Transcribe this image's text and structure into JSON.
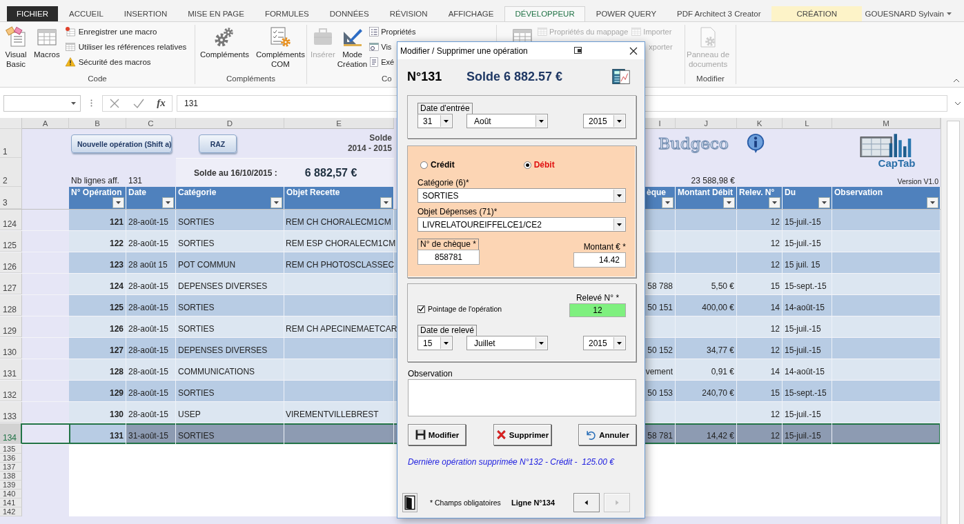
{
  "ribbon_tabs": [
    {
      "label": "FICHIER",
      "selected": false,
      "kind": "file"
    },
    {
      "label": "ACCUEIL",
      "selected": false,
      "kind": "tab"
    },
    {
      "label": "INSERTION",
      "selected": false,
      "kind": "tab"
    },
    {
      "label": "MISE EN PAGE",
      "selected": false,
      "kind": "tab"
    },
    {
      "label": "FORMULES",
      "selected": false,
      "kind": "tab"
    },
    {
      "label": "DONNÉES",
      "selected": false,
      "kind": "tab"
    },
    {
      "label": "RÉVISION",
      "selected": false,
      "kind": "tab"
    },
    {
      "label": "AFFICHAGE",
      "selected": false,
      "kind": "tab"
    },
    {
      "label": "DÉVELOPPEUR",
      "selected": true,
      "kind": "tab"
    },
    {
      "label": "POWER QUERY",
      "selected": false,
      "kind": "tab"
    },
    {
      "label": "PDF Architect 3 Creator",
      "selected": false,
      "kind": "tab"
    },
    {
      "label": "CRÉATION",
      "selected": false,
      "kind": "contextual"
    }
  ],
  "user": "GOUESNARD Sylvain",
  "ribbon_groups": [
    {
      "label": "Code",
      "large": [
        {
          "label": "Visual\nBasic",
          "disabled": false
        },
        {
          "label": "Macros",
          "disabled": false
        }
      ],
      "small": [
        {
          "label": "Enregistrer une macro",
          "disabled": false
        },
        {
          "label": "Utiliser les références relatives",
          "disabled": false
        },
        {
          "label": "Sécurité des macros",
          "disabled": false
        }
      ]
    },
    {
      "label": "Compléments",
      "large": [
        {
          "label": "Compléments",
          "disabled": false
        },
        {
          "label": "Compléments\nCOM",
          "disabled": false
        }
      ]
    },
    {
      "label": "Co",
      "large": [
        {
          "label": "Insérer",
          "disabled": true
        },
        {
          "label": "Mode\nCréation",
          "disabled": false
        }
      ],
      "small": [
        {
          "label": "Propriétés",
          "disabled": false
        },
        {
          "label": "Vis",
          "disabled": false
        },
        {
          "label": "Exé",
          "disabled": false
        }
      ]
    },
    {
      "large": [
        {
          "disabled": false
        }
      ],
      "small": [
        {
          "label": "Propriétés du mappage",
          "disabled": true
        },
        {
          "label": "Importer",
          "disabled": true
        },
        {
          "label": "xporter",
          "disabled": true
        }
      ]
    },
    {
      "label": "Modifier",
      "large": [
        {
          "label": "Panneau de\ndocuments",
          "disabled": true
        }
      ]
    }
  ],
  "formula_bar": {
    "function_label": "fx",
    "value": "131"
  },
  "sheet": {
    "columns": [
      "A",
      "B",
      "C",
      "D",
      "E",
      "I",
      "J",
      "K",
      "L",
      "M"
    ],
    "top_rows": [
      "1",
      "2",
      "3"
    ],
    "buttons": [
      "Nouvelle opération (Shift a)",
      "RAZ"
    ],
    "solde_title": [
      "Solde",
      "2014 - 2015"
    ],
    "logo": "Budgeco",
    "brand": "CapTab",
    "nb_lines_label": "Nb lignes aff.",
    "nb_lines_value": "131",
    "solde_label": "Solde au 16/10/2015 :",
    "solde_value": "6 882,57 €",
    "total_debit": "23 588,98 €",
    "version": "Version V1.0",
    "headers": [
      "N° Opération",
      "Date",
      "Catégorie",
      "Objet Recette",
      "èque",
      "Montant Débit",
      "Relev. N°",
      "Du",
      "Observation"
    ],
    "rows": [
      {
        "row": "124",
        "op": "121",
        "date": "28-août-15",
        "category": "SORTIES",
        "objet": "REM CH CHORALECM1CM",
        "releve": "12",
        "du": "15-juil.-15",
        "selected": false
      },
      {
        "row": "125",
        "op": "122",
        "date": "28-août-15",
        "category": "SORTIES",
        "objet": "REM ESP CHORALECM1CM",
        "releve": "12",
        "du": "15-juil.-15",
        "selected": false
      },
      {
        "row": "126",
        "op": "123",
        "date": "28 août 15",
        "category": "POT COMMUN",
        "objet": "REM CH PHOTOSCLASSEC",
        "releve": "12",
        "du": "15 juil. 15",
        "selected": false
      },
      {
        "row": "127",
        "op": "124",
        "date": "28-août-15",
        "category": "DEPENSES DIVERSES",
        "cheque": "58 788",
        "debit": "5,50 €",
        "releve": "15",
        "du": "15-sept.-15",
        "selected": false
      },
      {
        "row": "128",
        "op": "125",
        "date": "28-août-15",
        "category": "SORTIES",
        "cheque": "50 151",
        "debit": "400,00 €",
        "releve": "14",
        "du": "14-août-15",
        "selected": false
      },
      {
        "row": "129",
        "op": "126",
        "date": "28-août-15",
        "category": "SORTIES",
        "objet": "REM CH APECINEMAETCAR",
        "releve": "12",
        "du": "15-juil.-15",
        "selected": false
      },
      {
        "row": "130",
        "op": "127",
        "date": "28-août-15",
        "category": "DEPENSES DIVERSES",
        "cheque": "50 152",
        "debit": "34,77 €",
        "releve": "12",
        "du": "15-juil.-15",
        "selected": false
      },
      {
        "row": "131",
        "op": "128",
        "date": "28-août-15",
        "category": "COMMUNICATIONS",
        "cheque": "vement",
        "debit": "0,91 €",
        "releve": "14",
        "du": "14-août-15",
        "selected": false
      },
      {
        "row": "132",
        "op": "129",
        "date": "28-août-15",
        "category": "SORTIES",
        "cheque": "50 153",
        "debit": "240,70 €",
        "releve": "15",
        "du": "15-sept.-15",
        "selected": false
      },
      {
        "row": "133",
        "op": "130",
        "date": "28-août-15",
        "category": "USEP",
        "objet": "VIREMENTVILLEBREST",
        "releve": "12",
        "du": "15-juil.-15",
        "selected": false
      },
      {
        "row": "134",
        "op": "131",
        "date": "31-août-15",
        "category": "SORTIES",
        "cheque": "58 781",
        "debit": "14,42 €",
        "releve": "12",
        "du": "15-juil.-15",
        "selected": true
      }
    ],
    "empty_rows": [
      "135",
      "136",
      "137",
      "138",
      "139",
      "140",
      "141",
      "142"
    ]
  },
  "dialog": {
    "title": "Modifier / Supprimer une opération",
    "number": "N°131",
    "solde": "Solde 6 882.57 €",
    "entry_date": {
      "label": "Date d'entrée",
      "day": "31",
      "month": "Août",
      "year": "2015"
    },
    "type_options": [
      {
        "label": "Crédit",
        "selected": false
      },
      {
        "label": "Débit",
        "selected": true
      }
    ],
    "category": {
      "label": "Catégorie (6)*",
      "value": "SORTIES"
    },
    "objet": {
      "label": "Objet Dépenses (71)*",
      "value": "LIVRELATOUREIFFELCE1/CE2"
    },
    "cheque": {
      "label": "N° de chèque *",
      "value": "858781"
    },
    "amount": {
      "label": "Montant € *",
      "value": "14.42"
    },
    "pointage": {
      "label": "Pointage de l'opération",
      "checked": true
    },
    "releve": {
      "label": "Relevé N° *",
      "value": "12"
    },
    "releve_date": {
      "label": "Date de relevé",
      "day": "15",
      "month": "Juillet",
      "year": "2015"
    },
    "observation": {
      "label": "Observation"
    },
    "buttons": [
      {
        "label": "Modifier",
        "kind": "save"
      },
      {
        "label": "Supprimer",
        "kind": "delete"
      },
      {
        "label": "Annuler",
        "kind": "undo"
      }
    ],
    "last_deleted": "Dernière opération supprimée N°132 - Crédit -  125.00 €",
    "required_note": "* Champs obligatoires",
    "line": "Ligne N°134",
    "nav": [
      {
        "kind": "prev",
        "disabled": false
      },
      {
        "kind": "next",
        "disabled": true
      }
    ]
  }
}
